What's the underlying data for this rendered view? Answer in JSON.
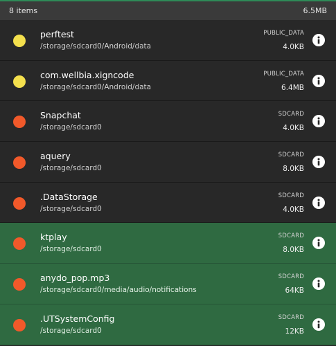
{
  "header": {
    "count": "8 items",
    "total_size": "6.5MB"
  },
  "colors": {
    "accent_green": "#2e8b57",
    "selected_row": "#2f6a41",
    "dot_yellow": "#f4e04d",
    "dot_orange": "#f1592a"
  },
  "items": [
    {
      "name": "perftest",
      "path": "/storage/sdcard0/Android/data",
      "type": "PUBLIC_DATA",
      "size": "4.0KB",
      "dot": "#f4e04d",
      "selected": false
    },
    {
      "name": "com.wellbia.xigncode",
      "path": "/storage/sdcard0/Android/data",
      "type": "PUBLIC_DATA",
      "size": "6.4MB",
      "dot": "#f4e04d",
      "selected": false
    },
    {
      "name": "Snapchat",
      "path": "/storage/sdcard0",
      "type": "SDCARD",
      "size": "4.0KB",
      "dot": "#f1592a",
      "selected": false
    },
    {
      "name": "aquery",
      "path": "/storage/sdcard0",
      "type": "SDCARD",
      "size": "8.0KB",
      "dot": "#f1592a",
      "selected": false
    },
    {
      "name": ".DataStorage",
      "path": "/storage/sdcard0",
      "type": "SDCARD",
      "size": "4.0KB",
      "dot": "#f1592a",
      "selected": false
    },
    {
      "name": "ktplay",
      "path": "/storage/sdcard0",
      "type": "SDCARD",
      "size": "8.0KB",
      "dot": "#f1592a",
      "selected": true
    },
    {
      "name": "anydo_pop.mp3",
      "path": "/storage/sdcard0/media/audio/notifications",
      "type": "SDCARD",
      "size": "64KB",
      "dot": "#f1592a",
      "selected": true
    },
    {
      "name": ".UTSystemConfig",
      "path": "/storage/sdcard0",
      "type": "SDCARD",
      "size": "12KB",
      "dot": "#f1592a",
      "selected": true
    }
  ]
}
